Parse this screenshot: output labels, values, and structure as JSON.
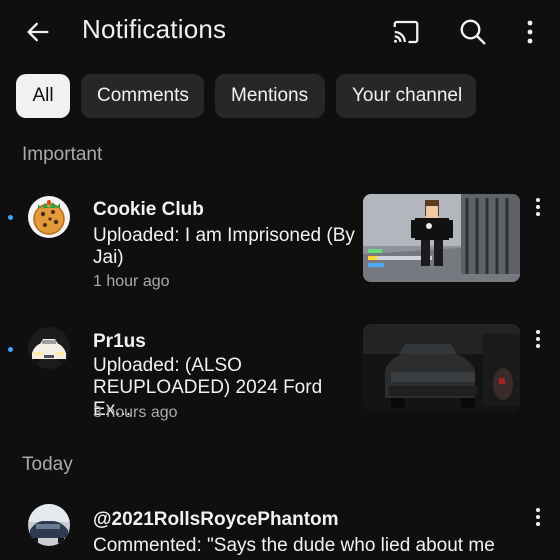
{
  "header": {
    "title": "Notifications"
  },
  "chips": [
    {
      "label": "All",
      "active": true
    },
    {
      "label": "Comments",
      "active": false
    },
    {
      "label": "Mentions",
      "active": false
    },
    {
      "label": "Your channel",
      "active": false
    }
  ],
  "sections": {
    "important": "Important",
    "today": "Today"
  },
  "notifications": [
    {
      "channel": "Cookie Club",
      "message": "Uploaded: I am Imprisoned (By Jai)",
      "time": "1 hour ago",
      "unread": true
    },
    {
      "channel": "Pr1us",
      "message": "Uploaded: (ALSO REUPLOADED) 2024 Ford Ex...",
      "time": "3 hours ago",
      "unread": true
    },
    {
      "channel": "@2021RollsRoycePhantom",
      "message": "Commented: \"Says the dude who lied about me",
      "unread": false
    }
  ],
  "icons": {
    "back": "arrow-left-icon",
    "cast": "cast-icon",
    "search": "search-icon",
    "menu": "more-vertical-icon"
  },
  "colors": {
    "background": "#0f0f0f",
    "chip": "#272727",
    "chip_active": "#f1f1f1",
    "unread_dot": "#3ea6ff",
    "secondary_text": "#aaaaaa"
  }
}
